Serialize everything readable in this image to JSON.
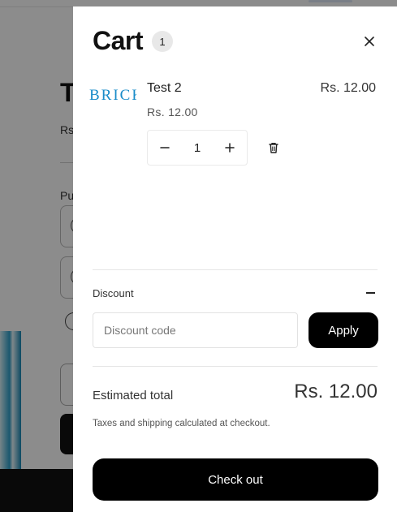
{
  "background": {
    "title_fragment": "T",
    "price_fragment": "Rs",
    "label_fragment": "Pu"
  },
  "cart": {
    "title": "Cart",
    "count": "1",
    "close_icon": "close-icon",
    "items": [
      {
        "name": "Test 2",
        "unit_price": "Rs. 12.00",
        "line_total": "Rs. 12.00",
        "quantity": "1",
        "thumbnail_text": "BRICK"
      }
    ],
    "discount": {
      "label": "Discount",
      "placeholder": "Discount code",
      "apply_label": "Apply"
    },
    "estimated_total_label": "Estimated total",
    "estimated_total_value": "Rs. 12.00",
    "tax_note": "Taxes and shipping calculated at checkout.",
    "checkout_label": "Check out"
  },
  "colors": {
    "accent": "#000000",
    "overlay": "#00000073",
    "thumbnail_brand": "#1a8cc9"
  }
}
